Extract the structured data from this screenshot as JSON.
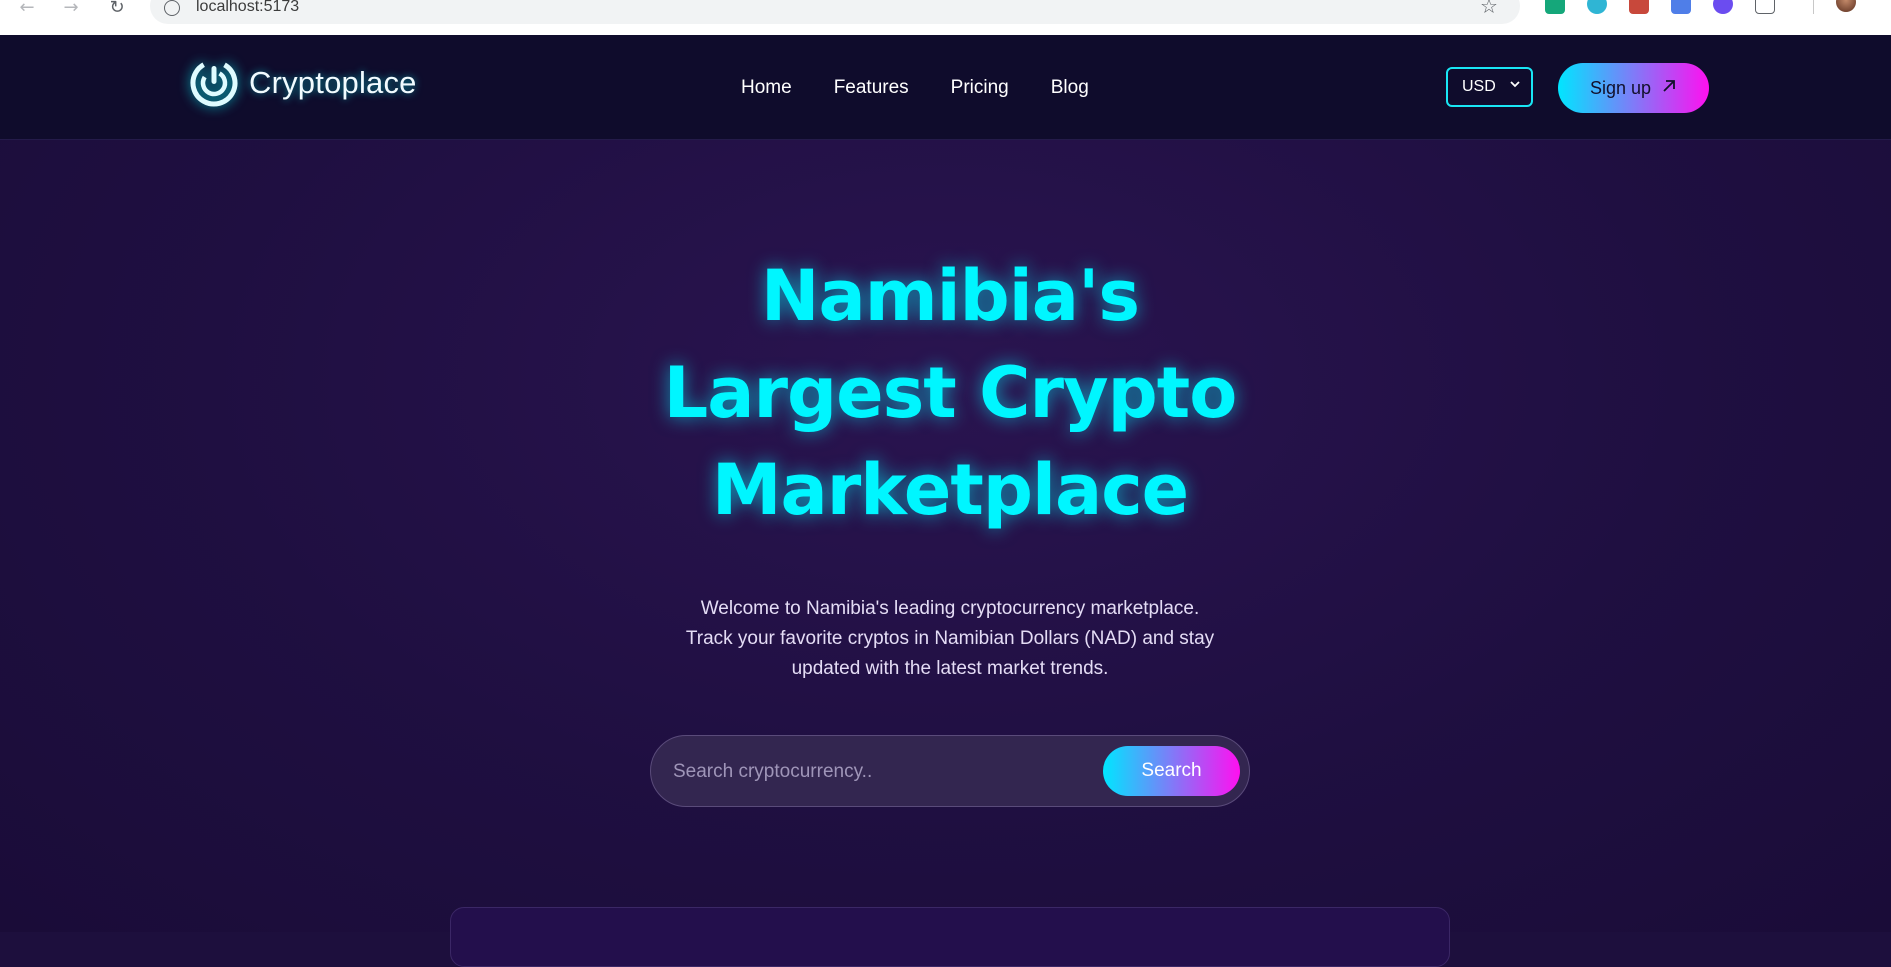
{
  "browser": {
    "url": "localhost:5173"
  },
  "header": {
    "logo_text": "Cryptoplace",
    "nav": [
      "Home",
      "Features",
      "Pricing",
      "Blog"
    ],
    "currency": "USD",
    "signup_label": "Sign up"
  },
  "hero": {
    "title_lines": [
      "Namibia's",
      "Largest Crypto",
      "Marketplace"
    ],
    "subtitle_lines": [
      "Welcome to Namibia's leading cryptocurrency marketplace.",
      "Track your favorite cryptos in Namibian Dollars (NAD) and stay",
      "updated with the latest market trends."
    ],
    "search_placeholder": "Search cryptocurrency..",
    "search_button": "Search"
  },
  "colors": {
    "accent_cyan": "#00f6ff",
    "accent_magenta": "#ff10f0",
    "header_bg": "#0f0c2c",
    "page_bg": "#1f0f41"
  },
  "icons": {
    "back": "arrow-left-icon",
    "forward": "arrow-right-icon",
    "reload": "reload-icon",
    "site_info": "info-icon",
    "bookmark": "star-icon",
    "signup": "arrow-up-right-icon"
  }
}
